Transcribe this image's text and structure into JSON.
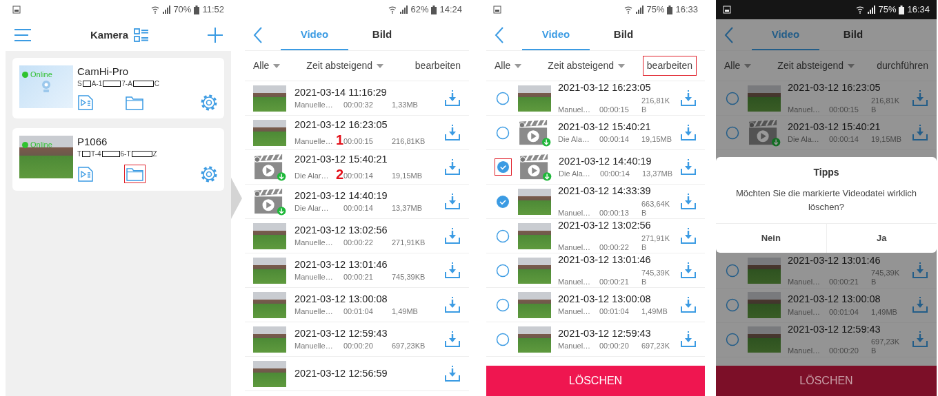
{
  "camera_screen": {
    "status_bar": {
      "notification_icon": true,
      "dark": false,
      "battery": "70%",
      "time": "11:52"
    },
    "title": "Kamera",
    "cameras": [
      {
        "name": "CamHi-Pro",
        "serial_parts": [
          "S",
          "A-1",
          "7-A",
          "C"
        ],
        "status": "Online",
        "kind": "placeholder",
        "folder_highlighted": false
      },
      {
        "name": "P1066",
        "serial_parts": [
          "T",
          "T-4",
          "6-T",
          "Z"
        ],
        "status": "Online",
        "kind": "photo",
        "folder_highlighted": true
      }
    ]
  },
  "video_screens": [
    {
      "status_bar": {
        "notification_icon": false,
        "dark": false,
        "battery": "62%",
        "time": "14:24"
      },
      "tabs": [
        {
          "label": "Video",
          "selected": true
        },
        {
          "label": "Bild",
          "selected": false
        }
      ],
      "filter": "Alle",
      "sort": "Zeit absteigend",
      "action": {
        "label": "bearbeiten",
        "highlighted": false
      },
      "edit_mode": false,
      "dimmed": false,
      "rows": [
        {
          "date": "2021-03-14 11:16:29",
          "source": "Manuelle…",
          "duration": "00:00:32",
          "size": "1,33MB",
          "kind": "photo"
        },
        {
          "date": "2021-03-12 16:23:05",
          "source": "Manuelle…",
          "annotation": "1",
          "duration": "00:00:15",
          "size": "216,81KB",
          "kind": "photo"
        },
        {
          "date": "2021-03-12 15:40:21",
          "source": "Die Alar…",
          "annotation": "2",
          "duration": "00:00:14",
          "size": "19,15MB",
          "kind": "clip"
        },
        {
          "date": "2021-03-12 14:40:19",
          "source": "Die Alar…",
          "duration": "00:00:14",
          "size": "13,37MB",
          "kind": "clip"
        },
        {
          "date": "2021-03-12 13:02:56",
          "source": "Manuelle…",
          "duration": "00:00:22",
          "size": "271,91KB",
          "kind": "photo"
        },
        {
          "date": "2021-03-12 13:01:46",
          "source": "Manuelle…",
          "duration": "00:00:21",
          "size": "745,39KB",
          "kind": "photo"
        },
        {
          "date": "2021-03-12 13:00:08",
          "source": "Manuelle…",
          "duration": "00:01:04",
          "size": "1,49MB",
          "kind": "photo"
        },
        {
          "date": "2021-03-12 12:59:43",
          "source": "Manuelle…",
          "duration": "00:00:20",
          "size": "697,23KB",
          "kind": "photo"
        },
        {
          "date": "2021-03-12 12:56:59",
          "kind": "photo"
        }
      ]
    },
    {
      "status_bar": {
        "notification_icon": true,
        "dark": false,
        "battery": "75%",
        "time": "16:33"
      },
      "tabs": [
        {
          "label": "Video",
          "selected": true
        },
        {
          "label": "Bild",
          "selected": false
        }
      ],
      "filter": "Alle",
      "sort": "Zeit absteigend",
      "action": {
        "label": "bearbeiten",
        "highlighted": true
      },
      "edit_mode": true,
      "dimmed": false,
      "rows": [
        {
          "date": "2021-03-12 16:23:05",
          "source": "Manuel…",
          "duration": "00:00:15",
          "size": "216,81KB",
          "kind": "photo",
          "checked": false,
          "highlighted": false
        },
        {
          "date": "2021-03-12 15:40:21",
          "source": "Die Ala…",
          "duration": "00:00:14",
          "size": "19,15MB",
          "kind": "clip",
          "checked": false,
          "highlighted": false
        },
        {
          "date": "2021-03-12 14:40:19",
          "source": "Die Ala…",
          "duration": "00:00:14",
          "size": "13,37MB",
          "kind": "clip",
          "checked": true,
          "highlighted": true
        },
        {
          "date": "2021-03-12 14:33:39",
          "source": "Manuel…",
          "duration": "00:00:13",
          "size": "663,64KB",
          "kind": "photo",
          "checked": true,
          "highlighted": false
        },
        {
          "date": "2021-03-12 13:02:56",
          "source": "Manuel…",
          "duration": "00:00:22",
          "size": "271,91KB",
          "kind": "photo",
          "checked": false,
          "highlighted": false
        },
        {
          "date": "2021-03-12 13:01:46",
          "source": "Manuel…",
          "duration": "00:00:21",
          "size": "745,39KB",
          "kind": "photo",
          "checked": false,
          "highlighted": false
        },
        {
          "date": "2021-03-12 13:00:08",
          "source": "Manuel…",
          "duration": "00:01:04",
          "size": "1,49MB",
          "kind": "photo",
          "checked": false,
          "highlighted": false
        },
        {
          "date": "2021-03-12 12:59:43",
          "source": "Manuel…",
          "duration": "00:00:20",
          "size": "697,23K",
          "kind": "photo",
          "checked": false,
          "highlighted": false
        }
      ],
      "delete_button": "LÖSCHEN"
    },
    {
      "status_bar": {
        "notification_icon": true,
        "dark": true,
        "battery": "75%",
        "time": "16:34"
      },
      "tabs": [
        {
          "label": "Video",
          "selected": true
        },
        {
          "label": "Bild",
          "selected": false
        }
      ],
      "filter": "Alle",
      "sort": "Zeit absteigend",
      "action": {
        "label": "durchführen",
        "highlighted": false
      },
      "edit_mode": true,
      "dimmed": true,
      "rows": [
        {
          "date": "2021-03-12 16:23:05",
          "source": "Manuel…",
          "duration": "00:00:15",
          "size": "216,81KB",
          "kind": "photo",
          "checked": false,
          "highlighted": false
        },
        {
          "date": "2021-03-12 15:40:21",
          "source": "Die Ala…",
          "duration": "00:00:14",
          "size": "19,15MB",
          "kind": "clip",
          "checked": false,
          "highlighted": false
        }
      ],
      "dialog": {
        "title": "Tipps",
        "message": "Möchten Sie die markierte Videodatei wirklich löschen?",
        "buttons": [
          "Nein",
          "Ja"
        ]
      },
      "rows_below_dialog": [
        {
          "date": "2021-03-12 13:01:46",
          "source": "Manuel…",
          "duration": "00:00:21",
          "size": "745,39KB",
          "kind": "photo",
          "checked": false,
          "highlighted": false
        },
        {
          "date": "2021-03-12 13:00:08",
          "source": "Manuel…",
          "duration": "00:01:04",
          "size": "1,49MB",
          "kind": "photo",
          "checked": false,
          "highlighted": false
        },
        {
          "date": "2021-03-12 12:59:43",
          "source": "Manuel…",
          "duration": "00:00:20",
          "size": "697,23KB",
          "kind": "photo",
          "checked": false,
          "highlighted": false
        }
      ],
      "delete_button": "LÖSCHEN"
    }
  ]
}
